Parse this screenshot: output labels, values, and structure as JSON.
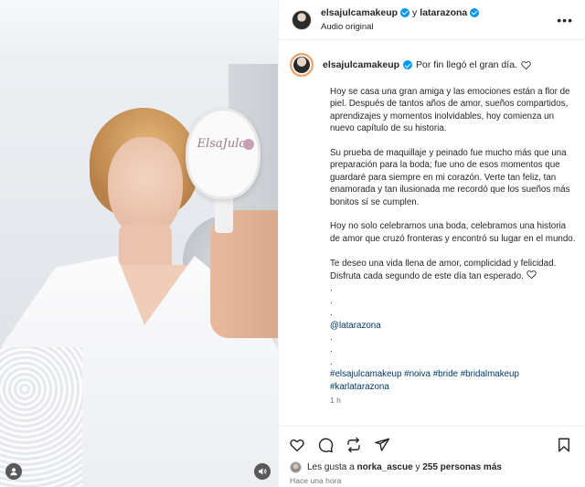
{
  "media": {
    "mirror_brand": "ElsaJulca"
  },
  "header": {
    "username": "elsajulcamakeup",
    "joiner": "y",
    "collaborator": "latarazona",
    "subtitle": "Audio original",
    "more_icon": "more-horizontal-icon"
  },
  "caption": {
    "username": "elsajulcamakeup",
    "title": "Por fin llegó el gran día.",
    "paragraphs": [
      "Hoy se casa una gran amiga y las emociones están a flor de piel. Después de tantos años de amor, sueños compartidos, aprendizajes y momentos inolvidables, hoy comienza un nuevo capítulo de su historia.",
      "Su prueba de maquillaje y peinado fue mucho más que una preparación para la boda; fue uno de esos momentos que guardaré para siempre en mi corazón. Verte tan feliz, tan enamorada y tan ilusionada me recordó que los sueños más bonitos sí se cumplen.",
      "Hoy no solo celebramos una boda, celebramos una historia de amor que cruzó fronteras y encontró su lugar en el mundo.",
      "Te deseo una vida llena de amor, complicidad y felicidad. Disfruta cada segundo de este día tan esperado."
    ],
    "dots_a": [
      ".",
      ".",
      "."
    ],
    "mention": "@latarazona",
    "dots_b": [
      ".",
      ".",
      "."
    ],
    "hashtags": "#elsajulcamakeup #noiva #bride #bridalmakeup #karlatarazona",
    "time": "1 h"
  },
  "actions": {
    "icons": [
      "heart-icon",
      "comment-icon",
      "repost-icon",
      "share-icon",
      "bookmark-icon"
    ]
  },
  "likes": {
    "prefix": "Les gusta a",
    "user": "norka_ascue",
    "middle": "y",
    "others": "255 personas más"
  },
  "posted_ago": "Hace una hora",
  "colors": {
    "verified": "#0095f6",
    "link": "#00376b",
    "muted": "#737373",
    "story_ring": "#f4a261"
  }
}
